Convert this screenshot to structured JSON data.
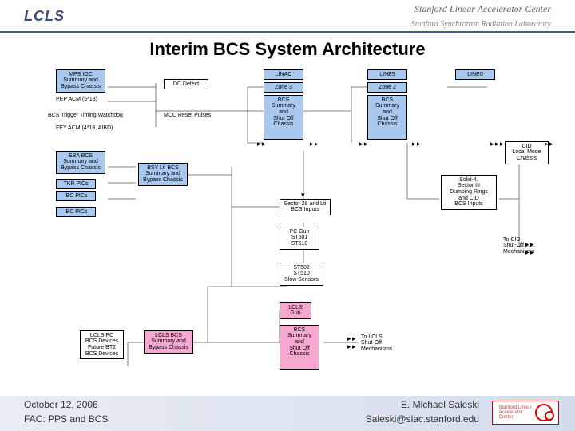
{
  "header": {
    "logo": "LCLS",
    "org1": "Stanford Linear Accelerator Center",
    "org2": "Stanford Synchrotron Radiation Laboratory"
  },
  "title": "Interim BCS System Architecture",
  "boxes": {
    "mps_ioc": "MPS IOC\nSummary and\nBypass Chassis",
    "pep_acm": "PEP ACM (5*18)",
    "dc_detect": "DC Detect",
    "bcs_trigger": "BCS Trigger Timing Watchdog",
    "mcc_reset": "MCC Reset Pulses",
    "fey_acm": "FEY ACM (4*18, AIBD)",
    "linac": "LINAC",
    "zone3": "Zone 3",
    "bcs_sum_shutoff1": "BCS\nSummary\nand\nShut Off\nChassis",
    "line5": "LINE5",
    "zone2": "Zone 2",
    "bcs_sum_shutoff2": "BCS\nSummary\nand\nShut Off\nChassis",
    "line0": "LINE0",
    "eba_bcs": "EBA BCS\nSummary and\nBypass Chassis",
    "tkr_pics": "TKR PICs",
    "ibc_pics": "IBC PICs",
    "ibc_pics2": "IBC PICs",
    "bsy_bcs": "BSY Lti BCS\nSummary and\nBypass Chassis",
    "sector28": "Sector 28 and Lti\nBCS Inputs",
    "pc_gun": "PC Gun\nST501\nST510",
    "st502": "ST502\nST510\nSlow Sensors",
    "lcls_gun": "LCLS\nGun",
    "lcls_pc": "LCLS PC\nBCS Devices\nFuture BT2\nBCS Devices",
    "lcls_bcs": "LCLS BCS\nSummary and\nBypass Chassis",
    "bcs_sum_pink": "BCS\nSummary\nand\nShut Off\nChassis",
    "to_lcls": "To LCLS\nShut-Off\nMechanisms",
    "solid4": "Solid-4,\nSector III\nDumping Rings\nand CID\nBCS Inputs",
    "cid_local": "CID\nLocal Mode\nChassis",
    "to_cid": "To CID\nShut-Off\nMechanisms"
  },
  "arrows": {
    "tri": "▸",
    "tridown": "▾"
  },
  "footer": {
    "date": "October 12, 2006",
    "fac": "FAC: PPS and BCS",
    "author": "E. Michael Saleski",
    "email": "Saleski@slac.stanford.edu",
    "logo_text": "Stanford Linear\nAccelerator\nCenter"
  }
}
